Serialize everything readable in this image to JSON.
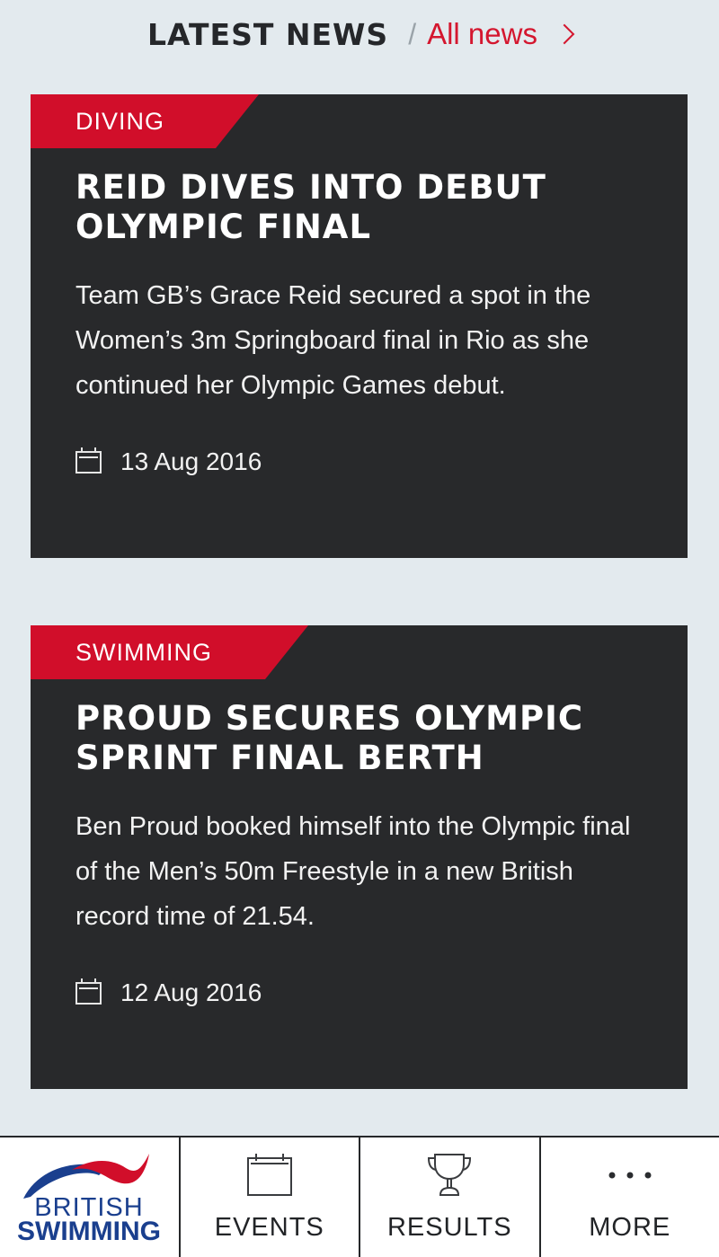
{
  "header": {
    "title": "LATEST NEWS",
    "separator": "/",
    "all_news_label": "All news"
  },
  "articles": [
    {
      "category": "DIVING",
      "title": "REID DIVES INTO DEBUT OLYMPIC FINAL",
      "summary": "Team GB’s Grace Reid secured a spot in the Women’s 3m Springboard final in Rio as she continued her Olympic Games debut.",
      "date": "13 Aug 2016"
    },
    {
      "category": "SWIMMING",
      "title": "PROUD SECURES OLYMPIC SPRINT FINAL BERTH",
      "summary": "Ben Proud booked himself into the Olympic final of the Men’s 50m Freestyle in a new British record time of 21.54.",
      "date": "12 Aug 2016"
    }
  ],
  "tabbar": {
    "logo_line1": "BRITISH",
    "logo_line2": "SWIMMING",
    "tabs": [
      {
        "label": "EVENTS",
        "icon": "calendar-icon"
      },
      {
        "label": "RESULTS",
        "icon": "trophy-icon"
      },
      {
        "label": "MORE",
        "icon": "more-dots-icon"
      }
    ]
  },
  "colors": {
    "accent_red": "#d10e2a",
    "card_bg": "#28292b",
    "page_bg": "#e3eaee",
    "logo_blue": "#1a3f8e"
  }
}
